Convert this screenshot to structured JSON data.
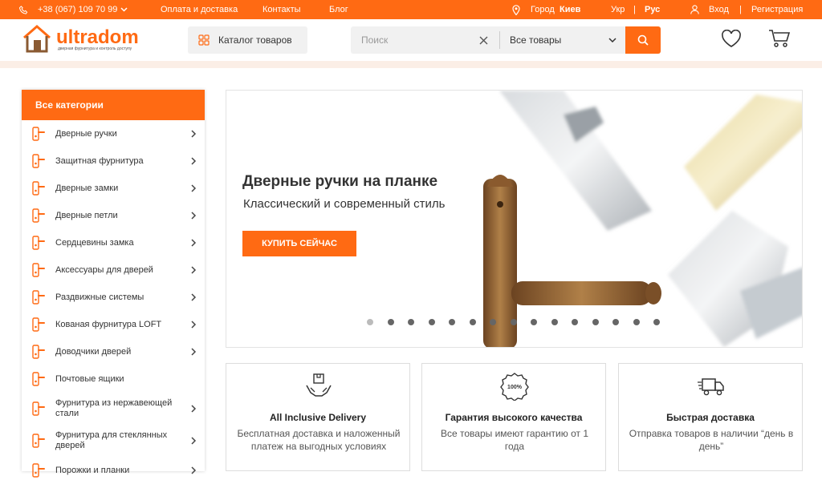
{
  "topbar": {
    "phone": "+38 (067) 109 70 99",
    "links": [
      "Оплата и доставка",
      "Контакты",
      "Блог"
    ],
    "city_label": "Город",
    "city": "Киев",
    "lang_ukr": "Укр",
    "lang_rus": "Рус",
    "login": "Вход",
    "register": "Регистрация"
  },
  "header": {
    "logo_text": "ultradom",
    "logo_sub": "дверная фурнитура и контроль доступу",
    "catalog_label": "Каталог товаров",
    "search_placeholder": "Поиск",
    "search_category": "Все товары"
  },
  "sidebar": {
    "title": "Все категории",
    "items": [
      {
        "label": "Дверные ручки",
        "icon": "door-handle-icon",
        "arrow": true
      },
      {
        "label": "Защитная фурнитура",
        "icon": "security-fitting-icon",
        "arrow": true
      },
      {
        "label": "Дверные замки",
        "icon": "door-lock-icon",
        "arrow": true
      },
      {
        "label": "Дверные петли",
        "icon": "door-hinge-icon",
        "arrow": true
      },
      {
        "label": "Сердцевины замка",
        "icon": "lock-cylinder-icon",
        "arrow": true
      },
      {
        "label": "Аксессуары для дверей",
        "icon": "door-accessories-icon",
        "arrow": true
      },
      {
        "label": "Раздвижные системы",
        "icon": "sliding-system-icon",
        "arrow": true
      },
      {
        "label": "Кованая фурнитура LOFT",
        "icon": "forged-fitting-icon",
        "arrow": true
      },
      {
        "label": "Доводчики дверей",
        "icon": "door-closer-icon",
        "arrow": true
      },
      {
        "label": "Почтовые ящики",
        "icon": "mailbox-icon",
        "arrow": false
      },
      {
        "label": "Фурнитура из нержавеющей стали",
        "icon": "stainless-steel-icon",
        "arrow": true
      },
      {
        "label": "Фурнитура для стеклянных дверей",
        "icon": "glass-door-icon",
        "arrow": true
      },
      {
        "label": "Порожки и планки",
        "icon": "threshold-icon",
        "arrow": true
      }
    ]
  },
  "banner": {
    "title": "Дверные ручки на планке",
    "subtitle": "Классический и современный стиль",
    "button": "КУПИТЬ СЕЙЧАС",
    "slides_count": 15,
    "active_slide": 1
  },
  "features": [
    {
      "title": "All Inclusive Delivery",
      "desc": "Бесплатная доставка и наложенный платеж на выгодных условиях",
      "icon": "delivery-hands-icon"
    },
    {
      "title": "Гарантия высокого качества",
      "desc": "Все товары имеют гарантию от 1 года",
      "icon": "quality-badge-icon"
    },
    {
      "title": "Быстрая доставка",
      "desc": "Отправка товаров в наличии “день в день”",
      "icon": "truck-icon"
    }
  ],
  "colors": {
    "accent": "#ff6a13",
    "strip": "#fbeee6",
    "text": "#333333"
  }
}
